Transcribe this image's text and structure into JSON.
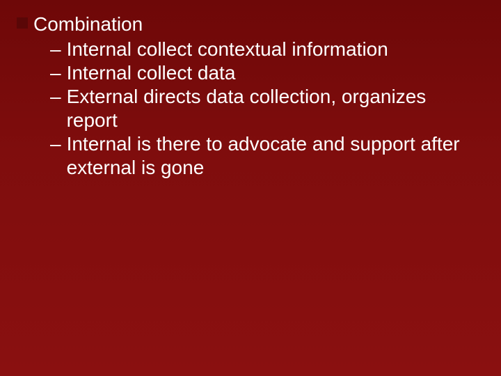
{
  "slide": {
    "bullet": "Combination",
    "subitems": [
      "Internal collect contextual information",
      "Internal collect data",
      "External directs data collection, organizes report",
      "Internal is there to advocate and support after external is gone"
    ]
  }
}
